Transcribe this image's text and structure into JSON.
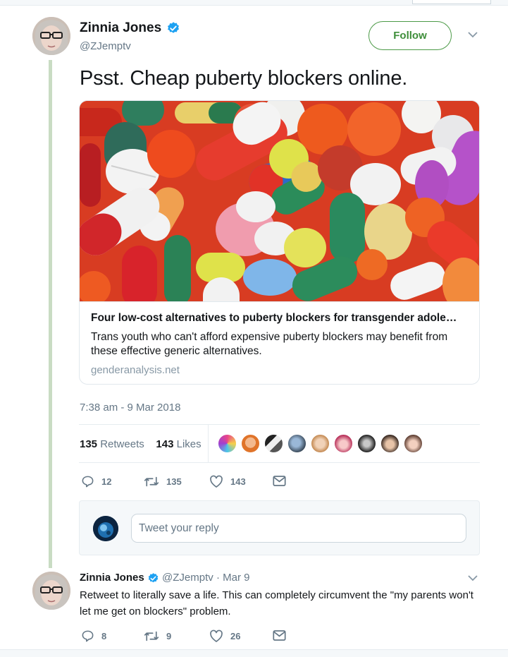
{
  "main_tweet": {
    "display_name": "Zinnia Jones",
    "handle": "@ZJemptv",
    "follow_label": "Follow",
    "text": "Psst. Cheap puberty blockers online.",
    "card": {
      "title": "Four low-cost alternatives to puberty blockers for transgender adole…",
      "description": "Trans youth who can't afford expensive puberty blockers may benefit from these effective generic alternatives.",
      "domain": "genderanalysis.net"
    },
    "timestamp": "7:38 am - 9 Mar 2018",
    "stats": {
      "retweets_count": "135",
      "retweets_label": "Retweets",
      "likes_count": "143",
      "likes_label": "Likes"
    },
    "actions": {
      "replies": "12",
      "retweets": "135",
      "likes": "143"
    }
  },
  "reply_composer": {
    "placeholder": "Tweet your reply"
  },
  "reply_tweet": {
    "display_name": "Zinnia Jones",
    "handle": "@ZJemptv",
    "date": "· Mar 9",
    "text": "Retweet to literally save a life. This can completely circumvent the \"my parents won't let me get on blockers\" problem.",
    "actions": {
      "replies": "8",
      "retweets": "9",
      "likes": "26"
    }
  },
  "icons": {
    "verified": "verified-badge-icon",
    "caret": "chevron-down-icon",
    "reply": "reply-icon",
    "retweet": "retweet-icon",
    "like": "heart-icon",
    "dm": "envelope-icon"
  },
  "colors": {
    "accent_green": "#3e8e3a",
    "verified_blue": "#1da1f2",
    "muted": "#657786",
    "thread_rail": "#c9dcc3"
  }
}
